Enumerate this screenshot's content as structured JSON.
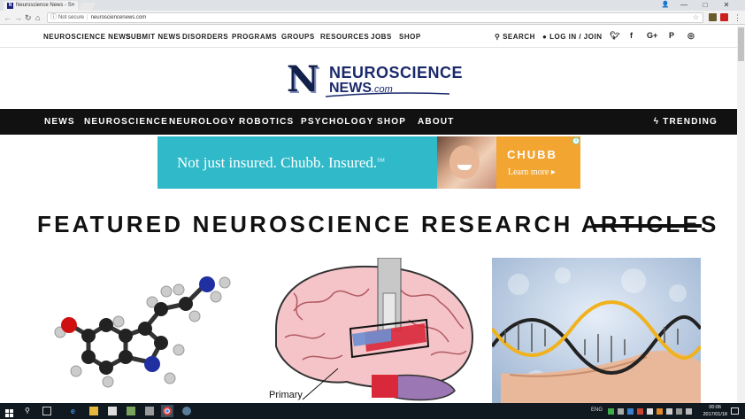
{
  "browser": {
    "tab_title": "Neuroscience News - S",
    "favicon_letter": "N",
    "security_label": "Not secure",
    "url": "neurosciencenews.com",
    "window_controls": [
      "—",
      "□",
      "✕"
    ]
  },
  "topnav": {
    "links": [
      "NEUROSCIENCE NEWS",
      "SUBMIT NEWS",
      "DISORDERS",
      "PROGRAMS",
      "GROUPS",
      "RESOURCES",
      "JOBS",
      "SHOP"
    ],
    "search": "SEARCH",
    "login": "LOG IN / JOIN",
    "social": [
      "twitter-icon",
      "facebook-icon",
      "googleplus-icon",
      "pinterest-icon",
      "instagram-icon"
    ]
  },
  "logo": {
    "letter": "N",
    "line1": "NEUROSCIENCE",
    "line2": "NEWS",
    "suffix": ".com"
  },
  "mainnav": {
    "links": [
      "NEWS",
      "NEUROSCIENCE",
      "NEUROLOGY",
      "ROBOTICS",
      "PSYCHOLOGY",
      "SHOP",
      "ABOUT"
    ],
    "trending": "TRENDING"
  },
  "ad": {
    "headline": "Not just insured. Chubb. Insured.",
    "mark": "SM",
    "brand": "CHUBB",
    "cta": "Learn more ▸",
    "info": "i"
  },
  "featured": {
    "title": "FEATURED NEUROSCIENCE RESEARCH ARTICLES",
    "cards": [
      {
        "image": "serotonin-molecule"
      },
      {
        "image": "brain-diagram",
        "label": "Primary"
      },
      {
        "image": "dna-hand"
      }
    ]
  },
  "taskbar": {
    "time": "00:06",
    "date": "2017/01/18",
    "tray": [
      "ENG"
    ],
    "colors": {
      "background": "#101820"
    }
  },
  "colors": {
    "nav_bg": "#111111",
    "logo_navy": "#1b2a6b",
    "ad_teal": "#2fb9c9",
    "ad_orange": "#f2a531"
  }
}
